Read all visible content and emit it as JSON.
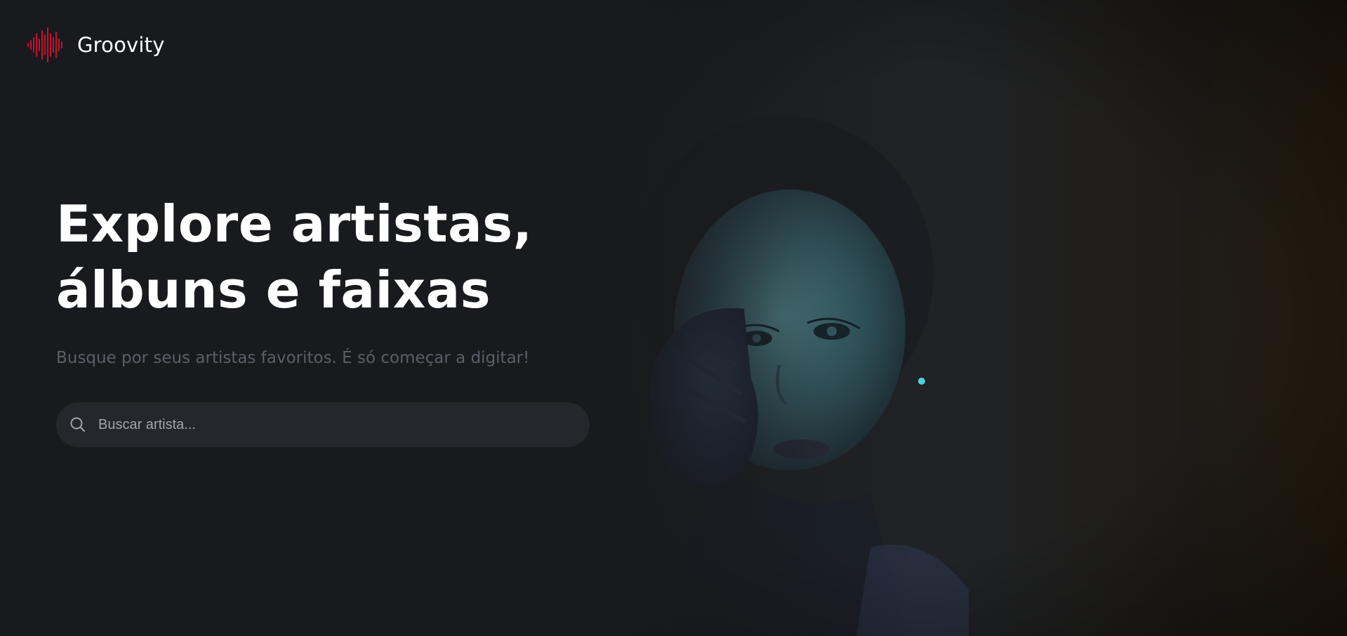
{
  "header": {
    "logo_text": "Groovity",
    "logo_icon": "sound-wave-icon"
  },
  "hero": {
    "headline_line1": "Explore artistas,",
    "headline_line2": "álbuns e faixas",
    "subtitle": "Busque por seus artistas favoritos. É só começar a digitar!"
  },
  "search": {
    "placeholder": "Buscar artista...",
    "value": "",
    "icon": "search-icon"
  },
  "colors": {
    "background": "#191a1e",
    "accent": "#c8102e",
    "search_bg": "#25272c",
    "subtitle": "#5b5f68"
  }
}
